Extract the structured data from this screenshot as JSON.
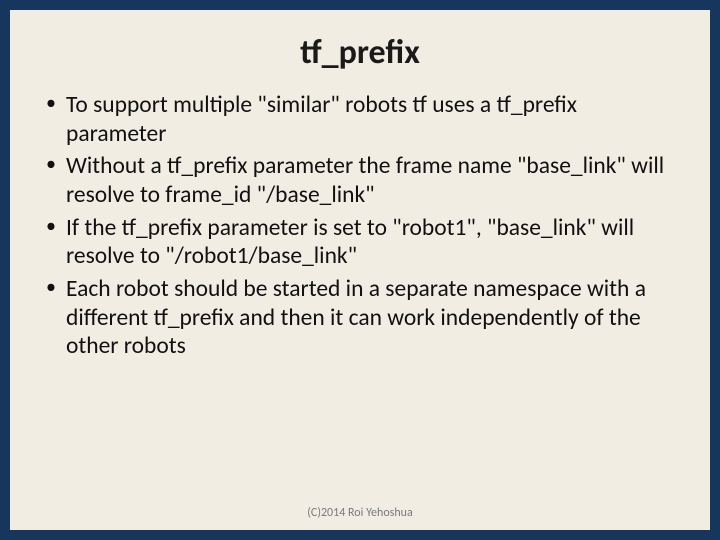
{
  "slide": {
    "title": "tf_prefix",
    "bullets": [
      "To support multiple \"similar\" robots tf uses a tf_prefix parameter",
      "Without a tf_prefix parameter the frame name \"base_link\" will resolve to frame_id \"/base_link\"",
      "If the tf_prefix parameter is set to \"robot1\", \"base_link\" will resolve to \"/robot1/base_link\"",
      "Each robot should be started in a separate namespace with a different tf_prefix and then it can work independently of the other robots"
    ],
    "footer": "(C)2014 Roi Yehoshua"
  }
}
